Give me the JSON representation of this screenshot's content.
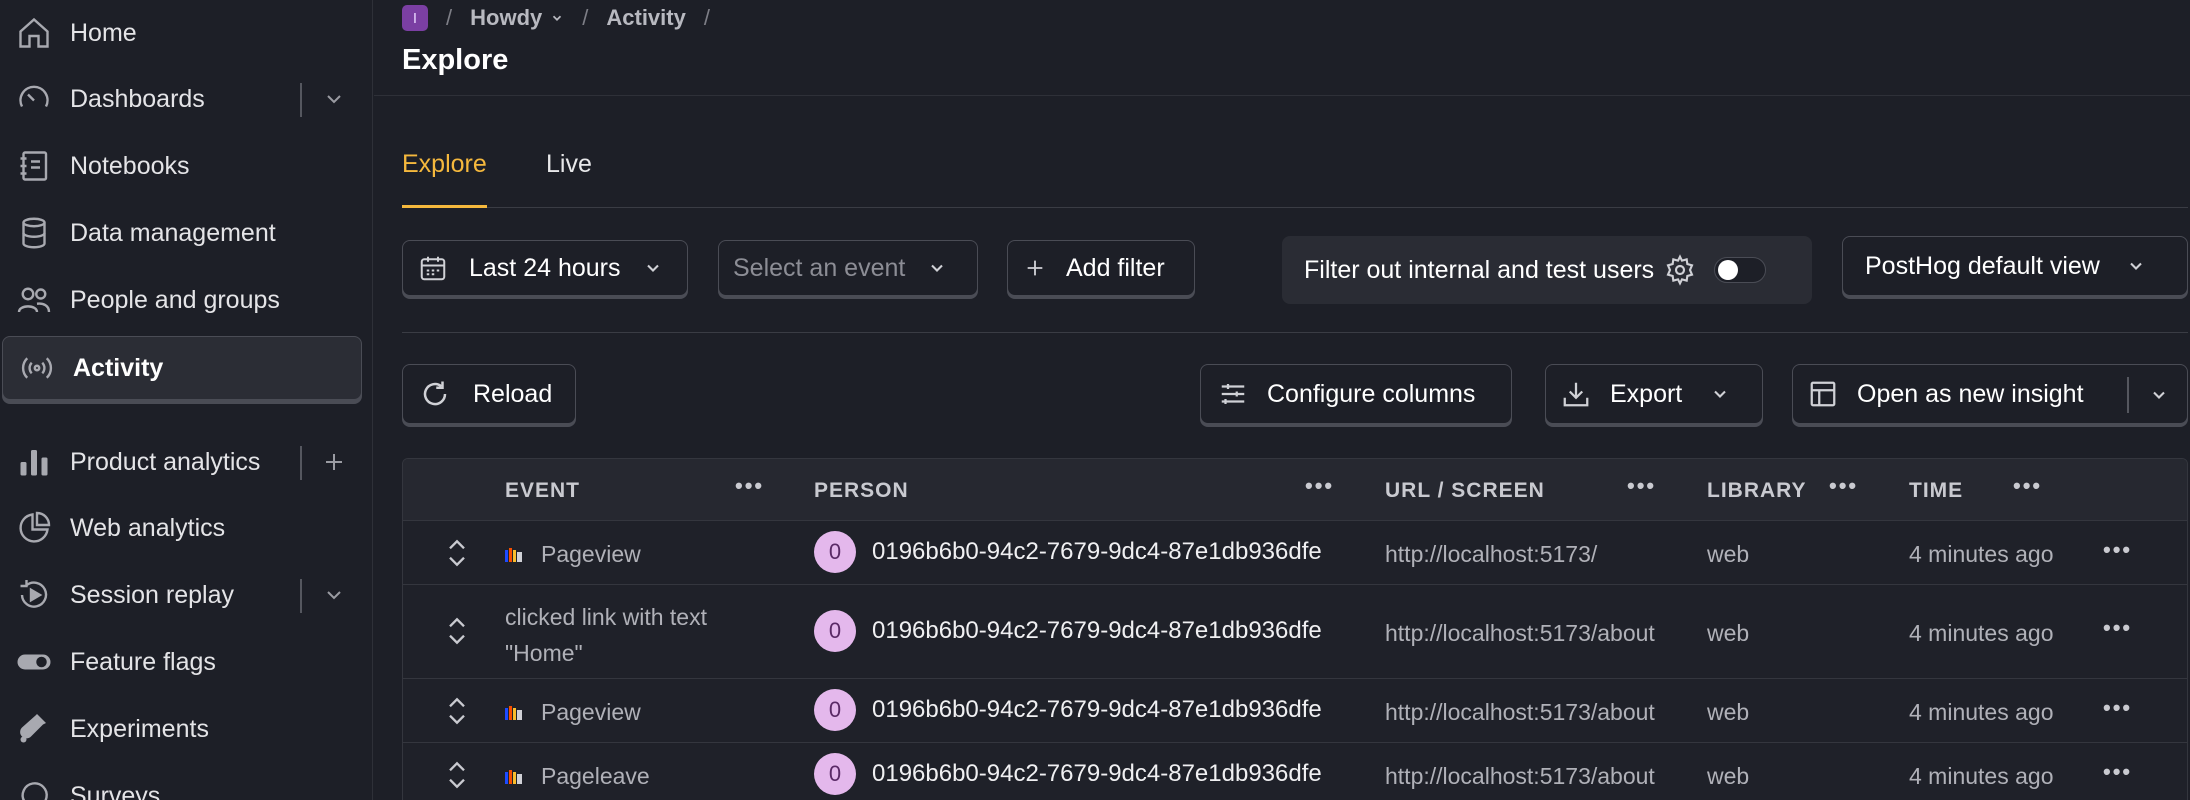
{
  "sidebar": {
    "items": [
      {
        "label": "Home",
        "icon": "home-icon"
      },
      {
        "label": "Dashboards",
        "icon": "dashboard-gauge-icon"
      },
      {
        "label": "Notebooks",
        "icon": "notebook-icon"
      },
      {
        "label": "Data management",
        "icon": "database-icon"
      },
      {
        "label": "People and groups",
        "icon": "people-icon"
      },
      {
        "label": "Activity",
        "icon": "broadcast-icon"
      },
      {
        "label": "Product analytics",
        "icon": "bar-chart-icon"
      },
      {
        "label": "Web analytics",
        "icon": "pie-chart-icon"
      },
      {
        "label": "Session replay",
        "icon": "replay-icon"
      },
      {
        "label": "Feature flags",
        "icon": "toggle-icon"
      },
      {
        "label": "Experiments",
        "icon": "flask-icon"
      },
      {
        "label": "Surveys",
        "icon": "survey-icon"
      }
    ]
  },
  "header": {
    "org_initial": "I",
    "project": "Howdy",
    "section": "Activity",
    "title": "Explore"
  },
  "tabs": [
    {
      "label": "Explore",
      "active": true
    },
    {
      "label": "Live",
      "active": false
    }
  ],
  "filters": {
    "date_range": "Last 24 hours",
    "event_placeholder": "Select an event",
    "add_filter": "Add filter",
    "internal_users": "Filter out internal and test users",
    "view": "PostHog default view"
  },
  "actions": {
    "reload": "Reload",
    "configure_columns": "Configure columns",
    "export": "Export",
    "open_insight": "Open as new insight"
  },
  "table": {
    "columns": [
      "EVENT",
      "PERSON",
      "URL / SCREEN",
      "LIBRARY",
      "TIME"
    ],
    "rows": [
      {
        "event": "Pageview",
        "event_line2": "",
        "has_logo": true,
        "person_initial": "0",
        "person": "0196b6b0-94c2-7679-9dc4-87e1db936dfe",
        "url": "http://localhost:5173/",
        "library": "web",
        "time": "4 minutes ago"
      },
      {
        "event": "clicked link with text",
        "event_line2": "\"Home\"",
        "has_logo": false,
        "person_initial": "0",
        "person": "0196b6b0-94c2-7679-9dc4-87e1db936dfe",
        "url": "http://localhost:5173/about",
        "library": "web",
        "time": "4 minutes ago"
      },
      {
        "event": "Pageview",
        "event_line2": "",
        "has_logo": true,
        "person_initial": "0",
        "person": "0196b6b0-94c2-7679-9dc4-87e1db936dfe",
        "url": "http://localhost:5173/about",
        "library": "web",
        "time": "4 minutes ago"
      },
      {
        "event": "Pageleave",
        "event_line2": "",
        "has_logo": true,
        "person_initial": "0",
        "person": "0196b6b0-94c2-7679-9dc4-87e1db936dfe",
        "url": "http://localhost:5173/about",
        "library": "web",
        "time": "4 minutes ago"
      }
    ]
  },
  "colors": {
    "background": "#1d1f27",
    "accent": "#f5b83d",
    "org_badge": "#7b3fa3",
    "avatar": "#e4b8ec"
  }
}
